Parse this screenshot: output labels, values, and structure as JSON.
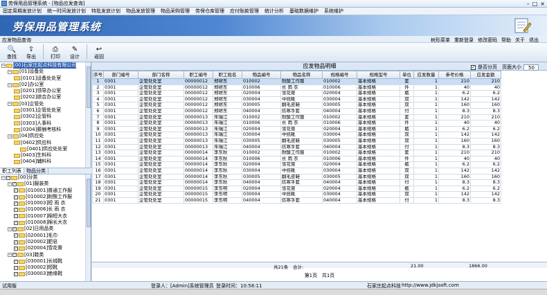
{
  "window": {
    "title": "劳保用品管理系统 - [物品应发查询]"
  },
  "menu": [
    "固定周期发放计划",
    "统一时间发放计划",
    "特批发放计划",
    "物品发放管理",
    "物品采购管理",
    "劳保仓库管理",
    "应付账款管理",
    "统计分析",
    "基础数据维护",
    "系统维护"
  ],
  "banner": {
    "title": "劳保用品管理系统"
  },
  "subbar": {
    "label": "应发物品查询",
    "links": [
      "树形菜单",
      "重新登录",
      "修改密码",
      "帮助",
      "关于",
      "退出"
    ]
  },
  "toolbar": {
    "buttons": [
      {
        "label": "查找",
        "icon": "search-icon"
      },
      {
        "label": "导出",
        "icon": "export-icon"
      },
      {
        "label": "打印",
        "icon": "print-icon"
      },
      {
        "label": "设计",
        "icon": "design-icon"
      },
      {
        "label": "返回",
        "icon": "return-icon"
      }
    ]
  },
  "tree_top": [
    {
      "text": "[00]石家庄起点科技有限公司",
      "level": 0,
      "sel": true
    },
    {
      "text": "[01]设备处",
      "level": 1
    },
    {
      "text": "[0101]设备处处室",
      "level": 2
    },
    {
      "text": "[02]办公室",
      "level": 1
    },
    {
      "text": "[0201]领导办公室",
      "level": 2
    },
    {
      "text": "[0202]综合办公室",
      "level": 2
    },
    {
      "text": "[03]企管处",
      "level": 1
    },
    {
      "text": "[0301]企管处处室",
      "level": 2
    },
    {
      "text": "[0302]企管科",
      "level": 2
    },
    {
      "text": "[0303]人事科",
      "level": 2
    },
    {
      "text": "[0304]薪酬考核科",
      "level": 2
    },
    {
      "text": "[04]供应处",
      "level": 1
    },
    {
      "text": "[0402]供应科",
      "level": 2
    },
    {
      "text": "[0401]供应处处室",
      "level": 3
    },
    {
      "text": "[0403]生料科",
      "level": 2
    },
    {
      "text": "[0404]辅料科",
      "level": 2
    }
  ],
  "tabs": [
    "职工列表",
    "物品分类"
  ],
  "tree_bottom": [
    {
      "text": "[00]分类",
      "level": 0
    },
    {
      "text": "[01]服装类",
      "level": 1
    },
    {
      "text": "[010001]普通工作服",
      "level": 2
    },
    {
      "text": "[010002]耐酸工作服",
      "level": 2
    },
    {
      "text": "[010003]短    雨    衣",
      "level": 2
    },
    {
      "text": "[010006]长    雨    衣",
      "level": 2
    },
    {
      "text": "[010007]棉短大衣",
      "level": 2
    },
    {
      "text": "[010008]棉长大衣",
      "level": 2
    },
    {
      "text": "[02]日用品类",
      "level": 1
    },
    {
      "text": "[020001]毛巾",
      "level": 2
    },
    {
      "text": "[020002]肥皂",
      "level": 2
    },
    {
      "text": "[020004]雪花膏",
      "level": 2
    },
    {
      "text": "[03]鞋类",
      "level": 1
    },
    {
      "text": "[030001]长绒靴",
      "level": 2
    },
    {
      "text": "[030002]短靴",
      "level": 2
    },
    {
      "text": "[030003]绝缘靴",
      "level": 2
    }
  ],
  "grid": {
    "title": "应发物品明细",
    "paging_label": "是否分页",
    "paging_checked": true,
    "page_size_label": "页面大小",
    "page_size": "50",
    "columns": [
      "序号",
      "部门编号",
      "部门名称",
      "职工编号",
      "职工姓名",
      "物品编号",
      "物品名称",
      "规格编号",
      "规格型号",
      "单位",
      "应发数量",
      "参考价格",
      "应发金额"
    ],
    "rows": [
      [
        "1",
        "0301",
        "企管处处室",
        "00000012",
        "郑继东",
        "010002",
        "耐酸工作服",
        "010002",
        "基本规格",
        "套",
        "1",
        "210",
        "210"
      ],
      [
        "2",
        "0301",
        "企管处处室",
        "00000012",
        "郑继东",
        "010006",
        "长  雨  衣",
        "010006",
        "基本规格",
        "件",
        "1",
        "40",
        "40"
      ],
      [
        "3",
        "0301",
        "企管处处室",
        "00000012",
        "郑继东",
        "020004",
        "雪花膏",
        "020004",
        "基本规格",
        "瓶",
        "1",
        "6.2",
        "6.2"
      ],
      [
        "4",
        "0301",
        "企管处处室",
        "00000012",
        "郑继东",
        "030004",
        "中统靴",
        "030004",
        "基本规格",
        "双",
        "1",
        "142",
        "142"
      ],
      [
        "5",
        "0301",
        "企管处处室",
        "00000012",
        "郑继东",
        "030005",
        "翻毛皮鞋",
        "030005",
        "基本规格",
        "双",
        "1",
        "160",
        "160"
      ],
      [
        "6",
        "0301",
        "企管处处室",
        "00000012",
        "郑继东",
        "040004",
        "防寒手套",
        "040004",
        "基本规格",
        "付",
        "1",
        "8.3",
        "8.3"
      ],
      [
        "7",
        "0301",
        "企管处处室",
        "00000013",
        "朱瑞江",
        "010002",
        "耐酸工作服",
        "010002",
        "基本规格",
        "套",
        "1",
        "210",
        "210"
      ],
      [
        "8",
        "0301",
        "企管处处室",
        "00000013",
        "朱瑞江",
        "010006",
        "长  雨  衣",
        "010006",
        "基本规格",
        "件",
        "1",
        "40",
        "40"
      ],
      [
        "9",
        "0301",
        "企管处处室",
        "00000013",
        "朱瑞江",
        "020004",
        "雪花膏",
        "020004",
        "基本规格",
        "瓶",
        "1",
        "6.2",
        "6.2"
      ],
      [
        "10",
        "0301",
        "企管处处室",
        "00000013",
        "朱瑞江",
        "030004",
        "中统靴",
        "030004",
        "基本规格",
        "双",
        "1",
        "142",
        "142"
      ],
      [
        "11",
        "0301",
        "企管处处室",
        "00000013",
        "朱瑞江",
        "030005",
        "翻毛皮鞋",
        "030005",
        "基本规格",
        "双",
        "1",
        "160",
        "160"
      ],
      [
        "12",
        "0301",
        "企管处处室",
        "00000013",
        "朱瑞江",
        "040004",
        "防寒手套",
        "040004",
        "基本规格",
        "付",
        "1",
        "8.3",
        "8.3"
      ],
      [
        "13",
        "0301",
        "企管处处室",
        "00000014",
        "李东秋",
        "010002",
        "耐酸工作服",
        "010002",
        "基本规格",
        "套",
        "1",
        "210",
        "210"
      ],
      [
        "14",
        "0301",
        "企管处处室",
        "00000014",
        "李东秋",
        "010006",
        "长  雨  衣",
        "010006",
        "基本规格",
        "件",
        "1",
        "40",
        "40"
      ],
      [
        "15",
        "0301",
        "企管处处室",
        "00000014",
        "李东秋",
        "020004",
        "雪花膏",
        "020004",
        "基本规格",
        "瓶",
        "1",
        "6.2",
        "6.2"
      ],
      [
        "16",
        "0301",
        "企管处处室",
        "00000014",
        "李东秋",
        "030004",
        "中统靴",
        "030004",
        "基本规格",
        "双",
        "1",
        "142",
        "142"
      ],
      [
        "17",
        "0301",
        "企管处处室",
        "00000014",
        "李东秋",
        "030005",
        "翻毛皮鞋",
        "030005",
        "基本规格",
        "双",
        "1",
        "160",
        "160"
      ],
      [
        "18",
        "0301",
        "企管处处室",
        "00000014",
        "李东秋",
        "040004",
        "防寒手套",
        "040004",
        "基本规格",
        "付",
        "1",
        "8.3",
        "8.3"
      ],
      [
        "19",
        "0301",
        "企管处处室",
        "00000015",
        "李东明",
        "020004",
        "雪花膏",
        "020004",
        "基本规格",
        "瓶",
        "1",
        "6.2",
        "6.2"
      ],
      [
        "20",
        "0301",
        "企管处处室",
        "00000015",
        "李东明",
        "030004",
        "中统靴",
        "030004",
        "基本规格",
        "双",
        "1",
        "142",
        "142"
      ],
      [
        "21",
        "0301",
        "企管处处室",
        "00000015",
        "李东明",
        "040004",
        "防寒手套",
        "040004",
        "基本规格",
        "付",
        "1",
        "8.3",
        "8.3"
      ]
    ],
    "footer": {
      "count": "共21条",
      "sum_label": "合计:",
      "qty_total": "21.00",
      "amount_total": "1866.00"
    },
    "pager": {
      "current": "第1页",
      "total": "共1页"
    }
  },
  "status": {
    "mode": "试用版",
    "user": "登录人：[Admin]系统管理员",
    "time": "登录时间：10:58:11",
    "company": "石家庄起点科技",
    "site": "http://www.jdkjsoft.com"
  }
}
